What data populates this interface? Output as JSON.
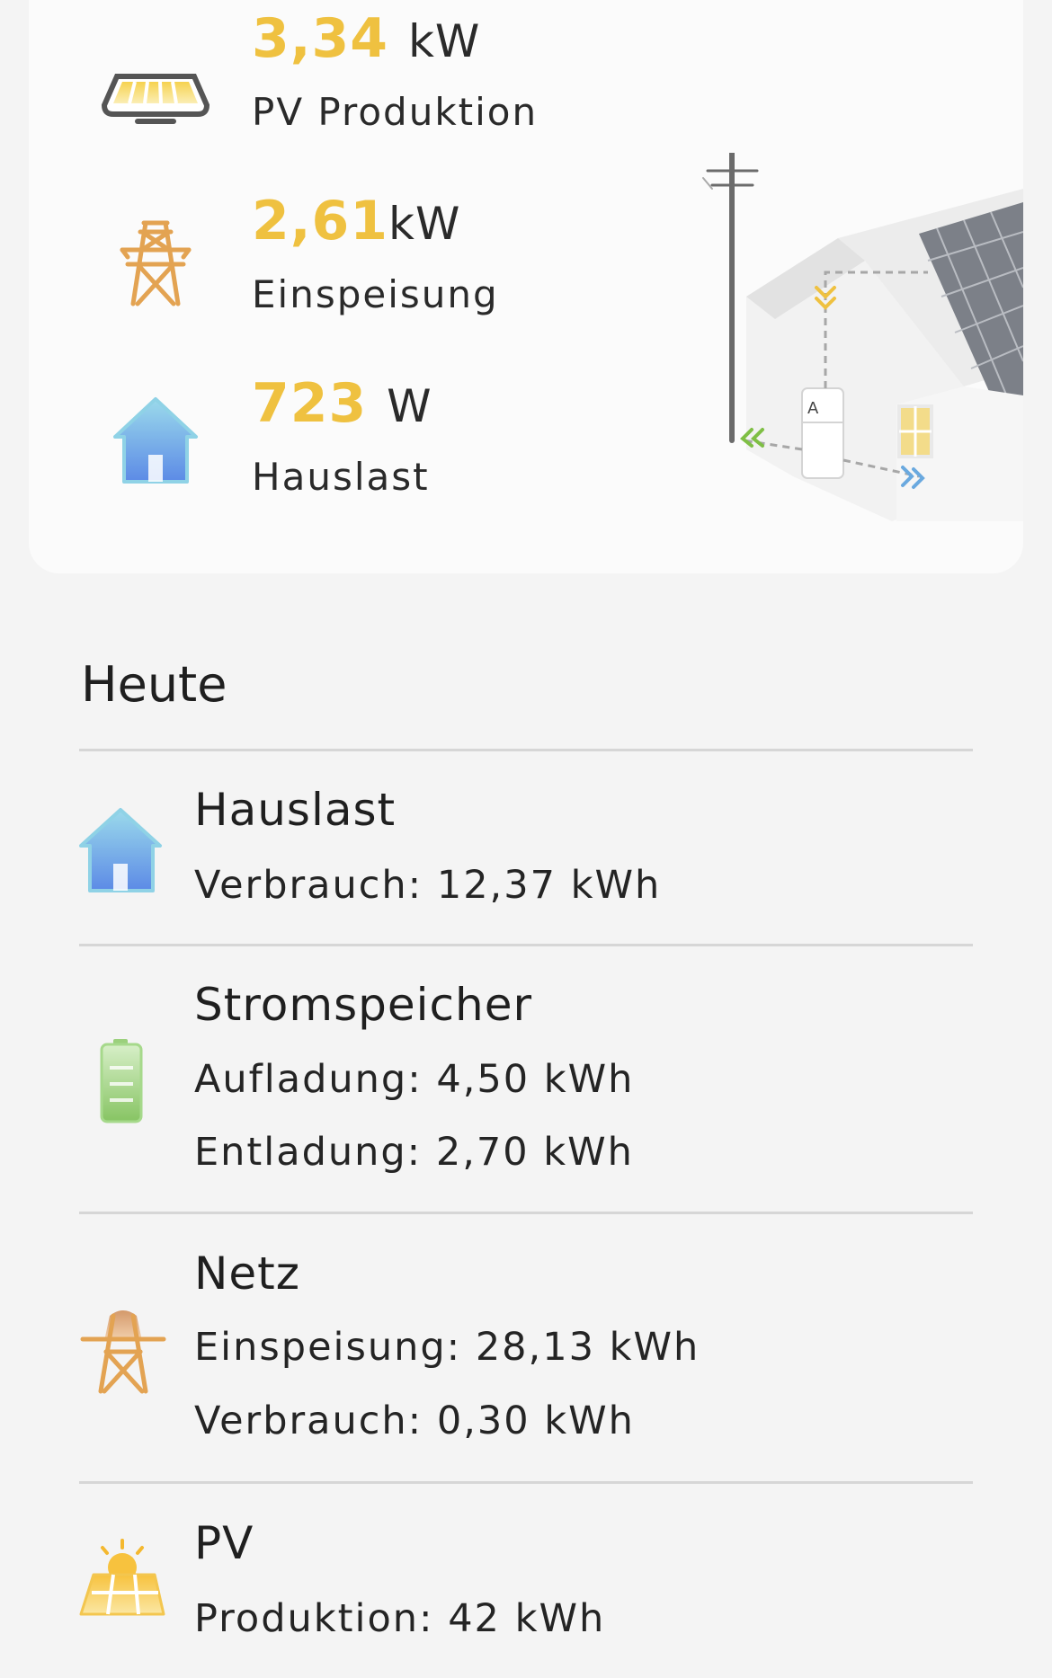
{
  "live": {
    "pv": {
      "value": "3,34",
      "unit": "kW",
      "label": "PV Produktion"
    },
    "grid": {
      "value": "2,61",
      "unit": "kW",
      "label": "Einspeisung"
    },
    "house": {
      "value": "723",
      "unit": "W",
      "label": "Hauslast"
    }
  },
  "today": {
    "title": "Heute",
    "hauslast": {
      "title": "Hauslast",
      "lines": [
        "Verbrauch: 12,37 kWh"
      ]
    },
    "storage": {
      "title": "Stromspeicher",
      "lines": [
        "Aufladung: 4,50 kWh",
        "Entladung: 2,70 kWh"
      ]
    },
    "netz": {
      "title": "Netz",
      "lines": [
        "Einspeisung: 28,13 kWh",
        "Verbrauch: 0,30 kWh"
      ]
    },
    "pv": {
      "title": "PV",
      "lines": [
        "Produktion: 42 kWh"
      ]
    }
  },
  "colors": {
    "accent": "#efc140",
    "grid_icon": "#e3a352",
    "house_icon_top": "#8ed3e8",
    "house_icon_bottom": "#5b8ee6",
    "battery": "#8cc66a",
    "arrow_green": "#7fbf45",
    "arrow_blue": "#6aa9df",
    "arrow_yellow": "#efc140"
  },
  "icons": {
    "pv_panel": "solar-panel-icon",
    "grid": "power-tower-icon",
    "house": "house-icon",
    "battery": "battery-icon",
    "pv_sun": "sun-panel-icon"
  }
}
